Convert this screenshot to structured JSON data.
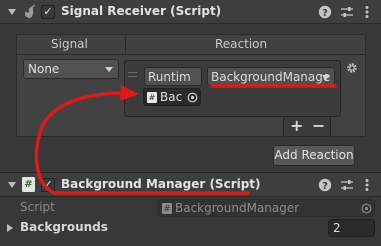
{
  "signal_receiver": {
    "title": "Signal Receiver (Script)",
    "enabled_check": "✓",
    "columns": {
      "signal": "Signal",
      "reaction": "Reaction"
    },
    "signal_value": "None",
    "target_object": "Runtim",
    "function_value": "BackgroundManage",
    "object_ref": "Bac",
    "add_label": "+",
    "remove_label": "−",
    "add_reaction_label": "Add Reaction"
  },
  "background_manager": {
    "title": "Background Manager (Script)",
    "enabled_check": "✓",
    "script_label": "Script",
    "script_value": "BackgroundManager",
    "backgrounds_label": "Backgrounds",
    "backgrounds_value": "2"
  },
  "header_icons": [
    "help-icon",
    "preset-icon",
    "more-icon"
  ],
  "colors": {
    "annotation": "#e01818",
    "panel": "#383838",
    "header": "#3e3e3e"
  }
}
